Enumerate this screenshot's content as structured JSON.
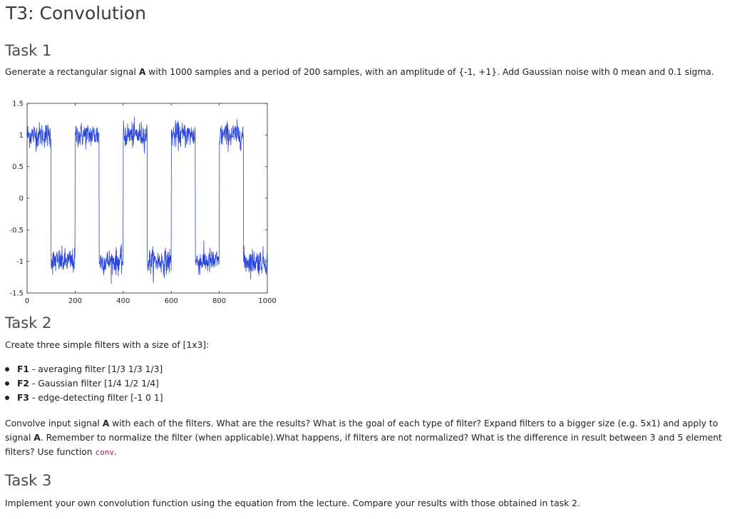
{
  "title": "T3: Convolution",
  "task1": {
    "heading": "Task 1",
    "text_before_A": "Generate a rectangular signal ",
    "signal_name": "A",
    "text_after_A": " with 1000 samples and a period of 200 samples, with an amplitude of {-1, +1}. Add Gaussian noise with 0 mean and 0.1 sigma."
  },
  "chart_data": {
    "type": "line",
    "title": "",
    "xlabel": "",
    "ylabel": "",
    "xlim": [
      0,
      1000
    ],
    "ylim": [
      -1.5,
      1.5
    ],
    "xticks": [
      "0",
      "200",
      "400",
      "600",
      "800",
      "1000"
    ],
    "xtick_values": [
      0,
      200,
      400,
      600,
      800,
      1000
    ],
    "yticks": [
      "1.5",
      "1",
      "0.5",
      "0",
      "-0.5",
      "-1",
      "-1.5"
    ],
    "ytick_values": [
      1.5,
      1,
      0.5,
      0,
      -0.5,
      -1,
      -1.5
    ],
    "grid": false,
    "series": [
      {
        "line_color": "#2a45d6",
        "segments": [
          {
            "x_start": 0,
            "x_end": 100,
            "level": 1
          },
          {
            "x_start": 100,
            "x_end": 200,
            "level": -1
          },
          {
            "x_start": 200,
            "x_end": 300,
            "level": 1
          },
          {
            "x_start": 300,
            "x_end": 400,
            "level": -1
          },
          {
            "x_start": 400,
            "x_end": 500,
            "level": 1
          },
          {
            "x_start": 500,
            "x_end": 600,
            "level": -1
          },
          {
            "x_start": 600,
            "x_end": 700,
            "level": 1
          },
          {
            "x_start": 700,
            "x_end": 800,
            "level": -1
          },
          {
            "x_start": 800,
            "x_end": 900,
            "level": 1
          },
          {
            "x_start": 900,
            "x_end": 1000,
            "level": -1
          }
        ],
        "samples": 1000,
        "noise_sigma": 0.1
      }
    ]
  },
  "task2": {
    "heading": "Task 2",
    "intro": "Create three simple filters with a size of [1x3]:",
    "filters": [
      {
        "name": "F1",
        "desc": " - averaging filter [1/3 1/3 1/3]"
      },
      {
        "name": "F2",
        "desc": " - Gaussian filter [1/4 1/2 1/4]"
      },
      {
        "name": "F3",
        "desc": " - edge-detecting filter [-1 0 1]"
      }
    ],
    "para_part1": "Convolve input signal ",
    "signal_name_1": "A",
    "para_part2": " with each of the filters. What are the results? What is the goal of each type of filter? Expand filters to a bigger size (e.g. 5x1) and apply to signal ",
    "signal_name_2": "A",
    "para_part3": ". Remember to normalize the filter (when applicable).What happens, if filters are not normalized? What is the difference in result between 3 and 5 element filters? Use function ",
    "code_fn": "conv",
    "para_end": "."
  },
  "task3": {
    "heading": "Task 3",
    "text": "Implement your own convolution function using the equation from the lecture. Compare your results with those obtained in task 2."
  }
}
